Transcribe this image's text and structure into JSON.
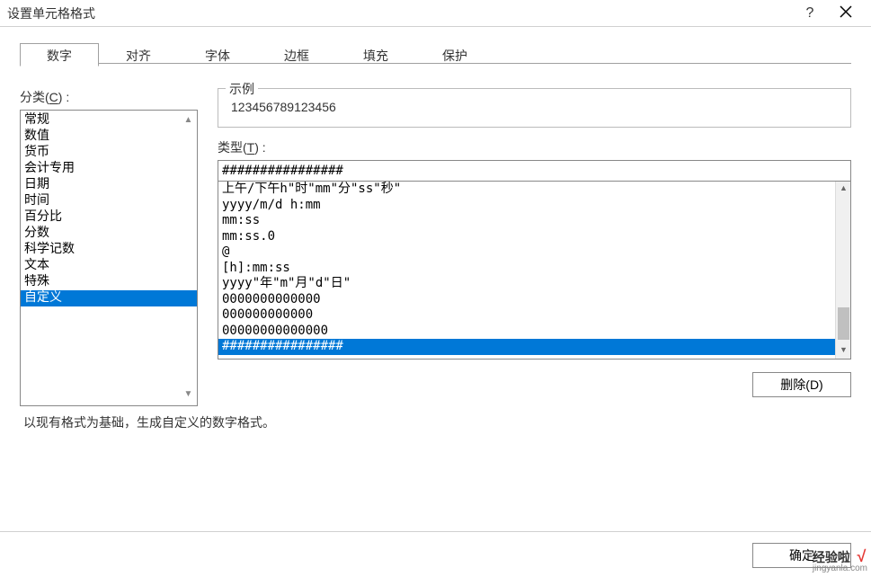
{
  "titlebar": {
    "title": "设置单元格格式",
    "help": "?"
  },
  "tabs": [
    "数字",
    "对齐",
    "字体",
    "边框",
    "填充",
    "保护"
  ],
  "activeTab": 0,
  "category": {
    "label_prefix": "分类(",
    "label_key": "C",
    "label_suffix": ") :",
    "items": [
      "常规",
      "数值",
      "货币",
      "会计专用",
      "日期",
      "时间",
      "百分比",
      "分数",
      "科学记数",
      "文本",
      "特殊",
      "自定义"
    ],
    "selectedIndex": 11
  },
  "example": {
    "label": "示例",
    "value": "123456789123456"
  },
  "type": {
    "label_prefix": "类型(",
    "label_key": "T",
    "label_suffix": ") :",
    "input": "################",
    "items": [
      "上午/下午h\"时\"mm\"分\"ss\"秒\"",
      "yyyy/m/d h:mm",
      "mm:ss",
      "mm:ss.0",
      "@",
      "[h]:mm:ss",
      "yyyy\"年\"m\"月\"d\"日\"",
      "0000000000000",
      "000000000000",
      "00000000000000",
      "################"
    ],
    "selectedIndex": 10
  },
  "deleteButton": "删除(D)",
  "hint": "以现有格式为基础，生成自定义的数字格式。",
  "footer": {
    "ok": "确定"
  },
  "watermark": {
    "top": "经验啦",
    "check": "√",
    "bottom": "jingyanla.com"
  },
  "icons": {
    "scrollUp": "▲",
    "scrollDown": "▼"
  }
}
